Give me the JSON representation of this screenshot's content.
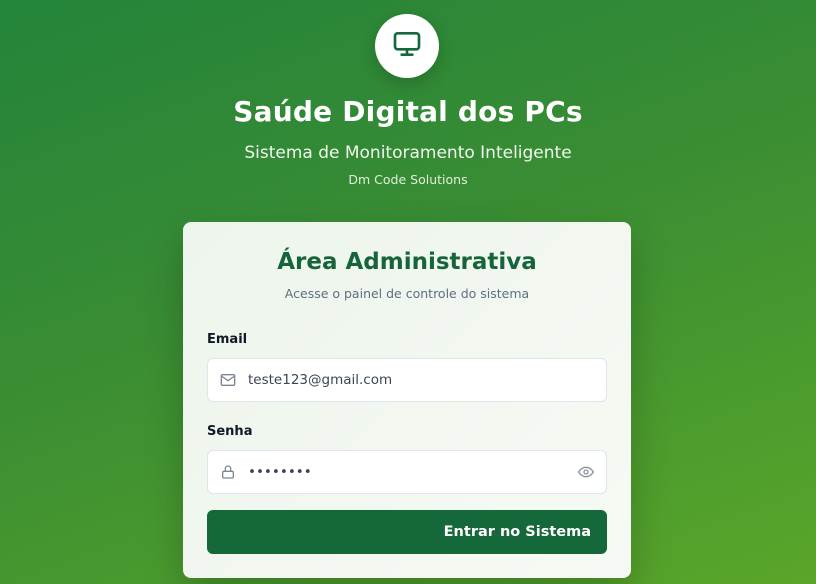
{
  "header": {
    "title": "Saúde Digital dos PCs",
    "subtitle": "Sistema de Monitoramento Inteligente",
    "company": "Dm Code Solutions",
    "logo_icon": "monitor-icon"
  },
  "login_card": {
    "title": "Área Administrativa",
    "subtitle": "Acesse o painel de controle do sistema",
    "email": {
      "label": "Email",
      "value": "teste123@gmail.com",
      "icon": "mail-icon"
    },
    "password": {
      "label": "Senha",
      "value": "••••••••",
      "icon": "lock-icon",
      "toggle_icon": "eye-icon"
    },
    "submit_label": "Entrar no Sistema"
  },
  "colors": {
    "brand_green": "#15683a",
    "background_start": "#23843a",
    "background_end": "#5aa62a"
  }
}
